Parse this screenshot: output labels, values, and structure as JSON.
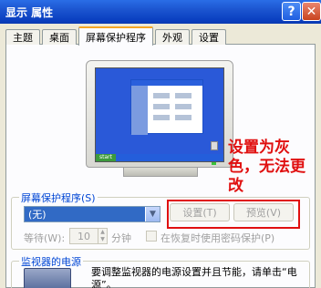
{
  "window": {
    "title": "显示 属性",
    "help_glyph": "?",
    "close_glyph": "✕"
  },
  "tabs": [
    {
      "label": "主题"
    },
    {
      "label": "桌面"
    },
    {
      "label": "屏幕保护程序",
      "active": true
    },
    {
      "label": "外观"
    },
    {
      "label": "设置"
    }
  ],
  "monitor": {
    "start_label": "start"
  },
  "annotation": {
    "text": "设置为灰色，无法更改",
    "color": "#e01010"
  },
  "screensaver": {
    "group_label": "屏幕保护程序(S)",
    "selected_value": "(无)",
    "settings_button": "设置(T)",
    "preview_button": "预览(V)",
    "wait_label": "等待(W):",
    "wait_value": "10",
    "minutes_label": "分钟",
    "password_checkbox_label": "在恢复时使用密码保护(P)"
  },
  "power": {
    "group_label": "监视器的电源",
    "description": "要调整监视器的电源设置并且节能，请单击“电源”。"
  },
  "colors": {
    "titlebar": "#0a3fc0",
    "tab_highlight": "#f5a623",
    "group_title": "#0046d5",
    "selection": "#316ac5"
  }
}
